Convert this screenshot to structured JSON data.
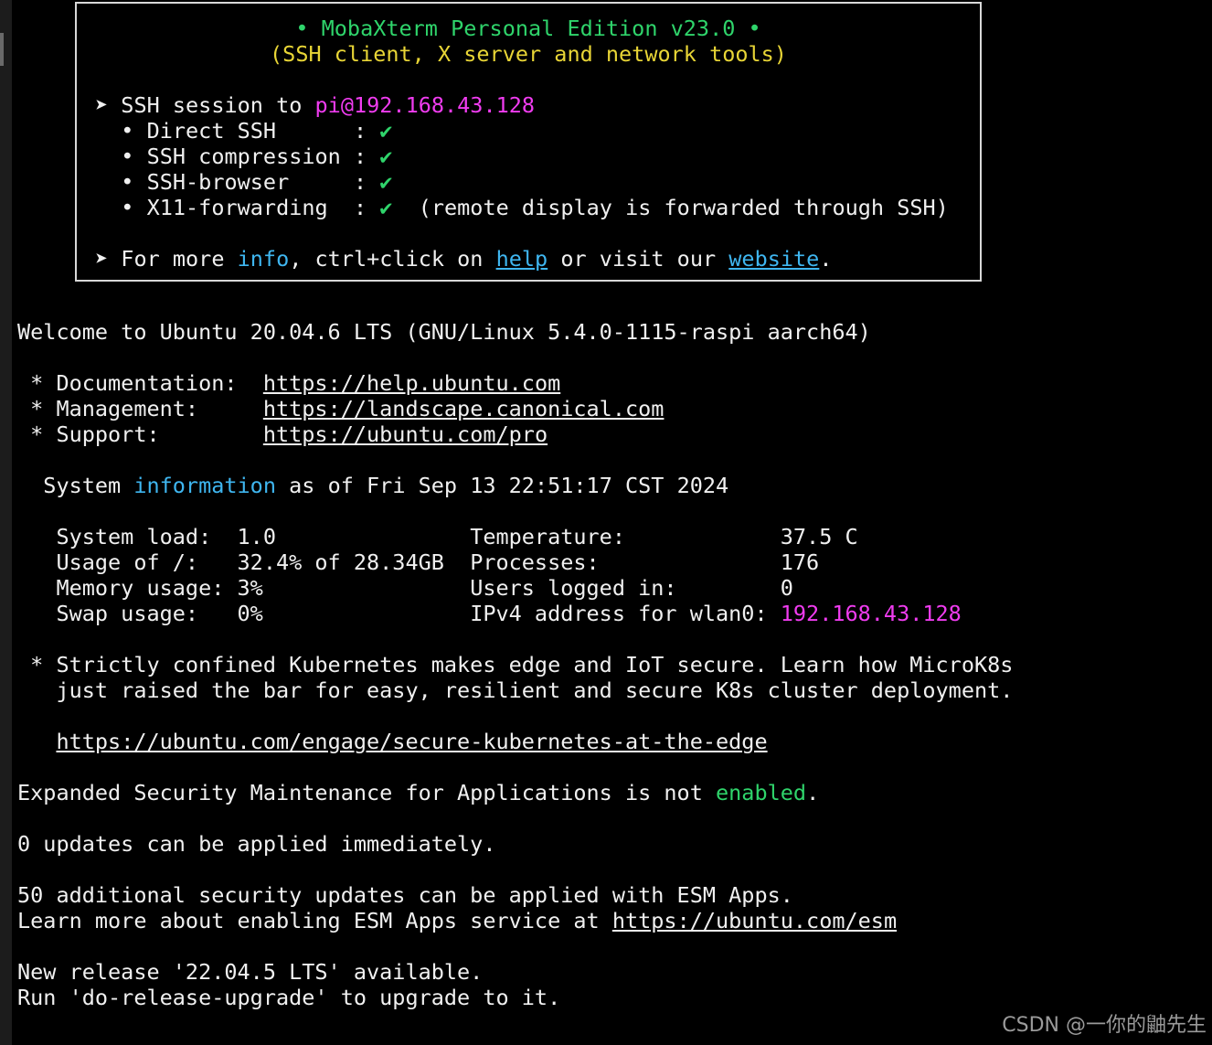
{
  "banner": {
    "title": "• MobaXterm Personal Edition v23.0 •",
    "subtitle": "(SSH client, X server and network tools)",
    "session_prefix": "➤ SSH session to ",
    "session_target": "pi@192.168.43.128",
    "features": [
      {
        "label": "• Direct SSH      : ",
        "check": "✔",
        "note": ""
      },
      {
        "label": "• SSH compression : ",
        "check": "✔",
        "note": ""
      },
      {
        "label": "• SSH-browser     : ",
        "check": "✔",
        "note": ""
      },
      {
        "label": "• X11-forwarding  : ",
        "check": "✔",
        "note": "  (remote display is forwarded through SSH)"
      }
    ],
    "more_prefix": "➤ For more ",
    "more_info": "info",
    "more_mid": ", ctrl+click on ",
    "more_help": "help",
    "more_mid2": " or visit our ",
    "more_website": "website",
    "more_end": "."
  },
  "terminal": {
    "welcome": "Welcome to Ubuntu 20.04.6 LTS (GNU/Linux 5.4.0-1115-raspi aarch64)",
    "docs": [
      {
        "label": " * Documentation:  ",
        "url": "https://help.ubuntu.com"
      },
      {
        "label": " * Management:     ",
        "url": "https://landscape.canonical.com"
      },
      {
        "label": " * Support:        ",
        "url": "https://ubuntu.com/pro"
      }
    ],
    "sysinfo_prefix": "  System ",
    "sysinfo_word": "information",
    "sysinfo_suffix": " as of Fri Sep 13 22:51:17 CST 2024",
    "stats": [
      {
        "left": "   System load:  1.0               ",
        "right": "Temperature:            37.5 C",
        "right_val": ""
      },
      {
        "left": "   Usage of /:   32.4% of 28.34GB  ",
        "right": "Processes:              176",
        "right_val": ""
      },
      {
        "left": "   Memory usage: 3%                ",
        "right": "Users logged in:        0",
        "right_val": ""
      },
      {
        "left": "   Swap usage:   0%                ",
        "right": "IPv4 address for wlan0: ",
        "right_val": "192.168.43.128"
      }
    ],
    "k8s_line1": " * Strictly confined Kubernetes makes edge and IoT secure. Learn how MicroK8s",
    "k8s_line2": "   just raised the bar for easy, resilient and secure K8s cluster deployment.",
    "k8s_url_indent": "   ",
    "k8s_url": "https://ubuntu.com/engage/secure-kubernetes-at-the-edge",
    "esm_prefix": "Expanded Security Maintenance for Applications is not ",
    "esm_word": "enabled",
    "esm_end": ".",
    "updates": "0 updates can be applied immediately.",
    "sec_updates": "50 additional security updates can be applied with ESM Apps.",
    "learn_prefix": "Learn more about enabling ESM Apps service at ",
    "learn_url": "https://ubuntu.com/esm",
    "release": "New release '22.04.5 LTS' available.",
    "run": "Run 'do-release-upgrade' to upgrade to it."
  },
  "watermark": "CSDN @一你的鼬先生",
  "colors": {
    "green": "#2fd46b",
    "yellow": "#e8d536",
    "magenta": "#f03cf0",
    "cyan": "#3fb6f0"
  }
}
